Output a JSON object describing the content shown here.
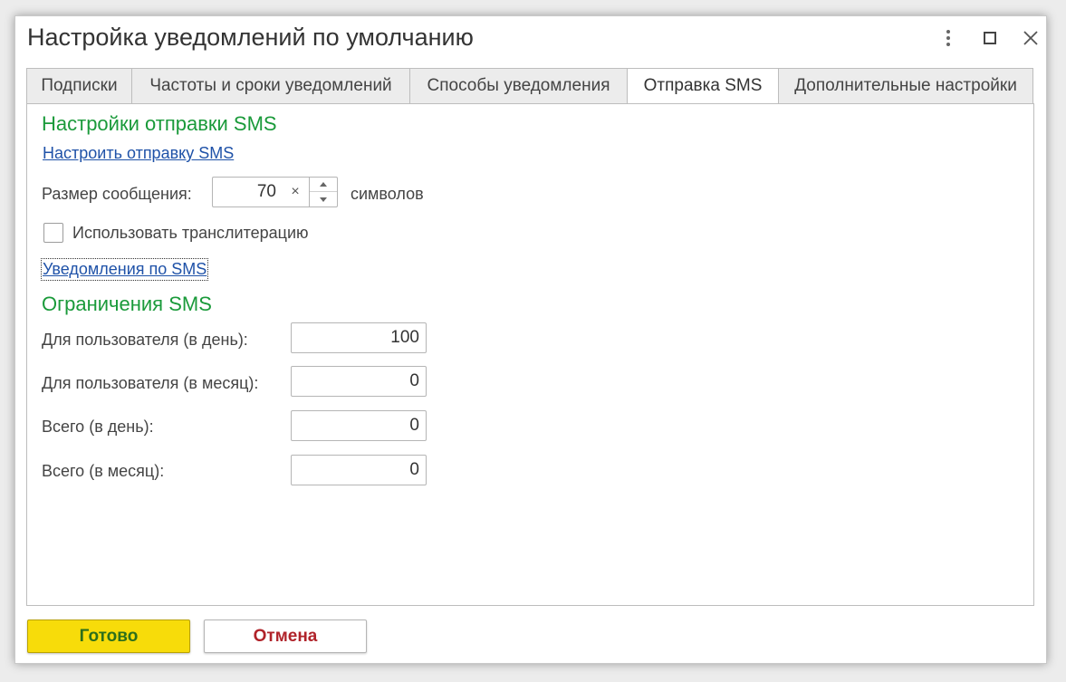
{
  "window": {
    "title": "Настройка уведомлений по умолчанию",
    "icons": {
      "menu": "more-vertical-icon",
      "maximize": "maximize-icon",
      "close": "close-icon"
    }
  },
  "tabs": [
    {
      "label": "Подписки"
    },
    {
      "label": "Частоты и сроки уведомлений"
    },
    {
      "label": "Способы уведомления"
    },
    {
      "label": "Отправка SMS",
      "active": true
    },
    {
      "label": "Дополнительные настройки"
    }
  ],
  "sms_settings": {
    "section_title": "Настройки отправки SMS",
    "configure_link": "Настроить отправку SMS",
    "message_size_label": "Размер сообщения:",
    "message_size_value": "70",
    "clear_symbol": "×",
    "message_size_unit": "символов",
    "transliteration_label": "Использовать транслитерацию",
    "transliteration_checked": false,
    "notifications_link": "Уведомления по SMS"
  },
  "limits": {
    "section_title": "Ограничения SMS",
    "rows": [
      {
        "label": "Для пользователя (в день):",
        "value": "100"
      },
      {
        "label": "Для пользователя (в месяц):",
        "value": "0"
      },
      {
        "label": "Всего (в день):",
        "value": "0"
      },
      {
        "label": "Всего (в месяц):",
        "value": "0"
      }
    ]
  },
  "buttons": {
    "ok": "Готово",
    "cancel": "Отмена"
  },
  "colors": {
    "section_title": "#1a9a3a",
    "link": "#1f52a8",
    "ok_button_bg": "#f7dc0a",
    "ok_button_text": "#2d6f1b",
    "cancel_button_text": "#b0232a"
  }
}
